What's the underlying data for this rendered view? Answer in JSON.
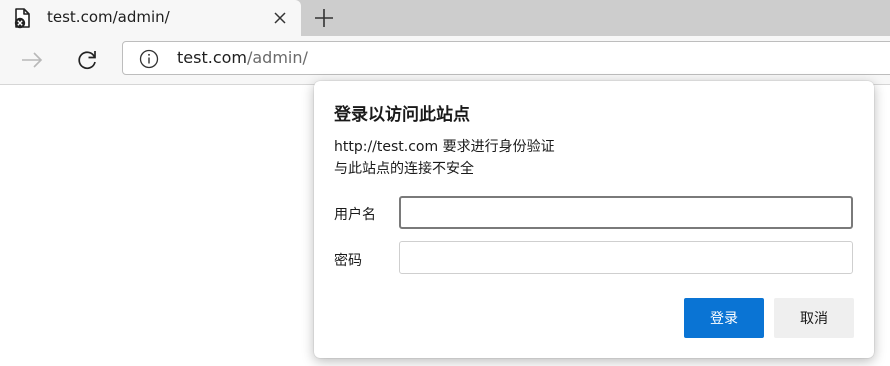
{
  "tab": {
    "title": "test.com/admin/",
    "favicon_icon": "insecure-page-icon",
    "close_icon": "close-icon"
  },
  "new_tab_icon": "plus-icon",
  "toolbar": {
    "forward_icon": "arrow-right-icon",
    "reload_icon": "reload-icon",
    "site_info_icon": "info-icon",
    "url_host": "test.com",
    "url_path": "/admin/"
  },
  "auth_dialog": {
    "title": "登录以访问此站点",
    "message_line1": "http://test.com 要求进行身份验证",
    "message_line2": "与此站点的连接不安全",
    "username_label": "用户名",
    "username_value": "",
    "password_label": "密码",
    "password_value": "",
    "login_button": "登录",
    "cancel_button": "取消"
  },
  "colors": {
    "accent": "#0a74d4",
    "tabstrip_bg": "#cdcdcd",
    "toolbar_bg": "#f7f7f7"
  }
}
